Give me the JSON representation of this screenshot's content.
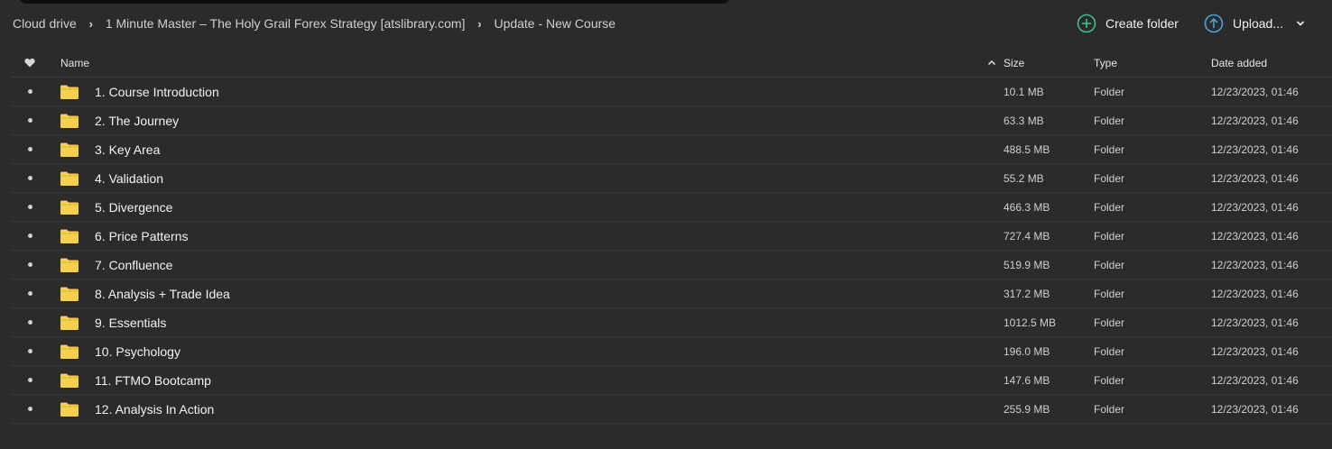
{
  "breadcrumb": [
    {
      "label": "Cloud drive"
    },
    {
      "label": "1 Minute Master – The Holy Grail Forex Strategy [atslibrary.com]"
    },
    {
      "label": "Update - New Course"
    }
  ],
  "actions": {
    "create_folder": "Create folder",
    "upload": "Upload..."
  },
  "columns": {
    "name": "Name",
    "size": "Size",
    "type": "Type",
    "date": "Date added"
  },
  "colors": {
    "folder": "#f5d04c",
    "create_icon": "#3fbf8a",
    "upload_icon": "#4aa3df"
  },
  "rows": [
    {
      "name": "1. Course Introduction",
      "size": "10.1 MB",
      "type": "Folder",
      "date": "12/23/2023, 01:46"
    },
    {
      "name": "2. The Journey",
      "size": "63.3 MB",
      "type": "Folder",
      "date": "12/23/2023, 01:46"
    },
    {
      "name": "3. Key Area",
      "size": "488.5 MB",
      "type": "Folder",
      "date": "12/23/2023, 01:46"
    },
    {
      "name": "4. Validation",
      "size": "55.2 MB",
      "type": "Folder",
      "date": "12/23/2023, 01:46"
    },
    {
      "name": "5. Divergence",
      "size": "466.3 MB",
      "type": "Folder",
      "date": "12/23/2023, 01:46"
    },
    {
      "name": "6. Price Patterns",
      "size": "727.4 MB",
      "type": "Folder",
      "date": "12/23/2023, 01:46"
    },
    {
      "name": "7. Confluence",
      "size": "519.9 MB",
      "type": "Folder",
      "date": "12/23/2023, 01:46"
    },
    {
      "name": "8. Analysis + Trade Idea",
      "size": "317.2 MB",
      "type": "Folder",
      "date": "12/23/2023, 01:46"
    },
    {
      "name": "9. Essentials",
      "size": "1012.5 MB",
      "type": "Folder",
      "date": "12/23/2023, 01:46"
    },
    {
      "name": "10. Psychology",
      "size": "196.0 MB",
      "type": "Folder",
      "date": "12/23/2023, 01:46"
    },
    {
      "name": "11. FTMO Bootcamp",
      "size": "147.6 MB",
      "type": "Folder",
      "date": "12/23/2023, 01:46"
    },
    {
      "name": "12. Analysis In Action",
      "size": "255.9 MB",
      "type": "Folder",
      "date": "12/23/2023, 01:46"
    }
  ]
}
